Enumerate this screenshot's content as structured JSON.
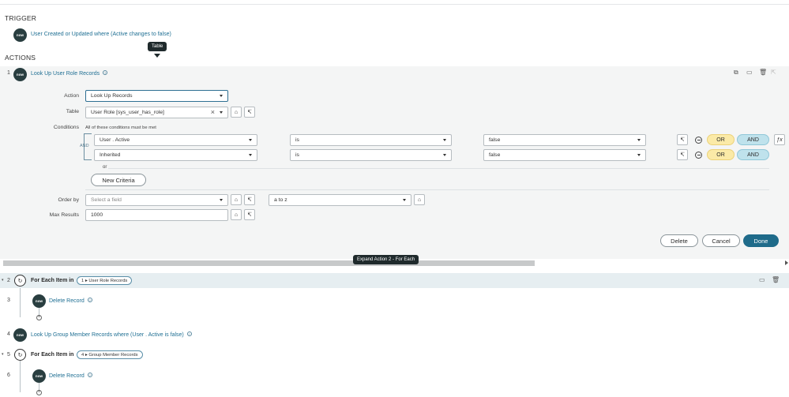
{
  "trigger": {
    "title": "TRIGGER",
    "logo": "now",
    "summary": "User Created or Updated where (Active changes to false)"
  },
  "actions_title": "ACTIONS",
  "table_tooltip": "Table",
  "step1": {
    "number": "1",
    "title": "Look Up User Role Records",
    "form": {
      "action_label": "Action",
      "action_value": "Look Up Records",
      "table_label": "Table",
      "table_value": "User Role [sys_user_has_role]",
      "conditions_label": "Conditions",
      "conditions_hint": "All of these conditions must be met",
      "and_connector": "AND",
      "or_divider": "or",
      "conditions": [
        {
          "field": "User . Active",
          "operator": "is",
          "value": "false",
          "or_label": "OR",
          "and_label": "AND"
        },
        {
          "field": "Inherited",
          "operator": "is",
          "value": "false",
          "or_label": "OR",
          "and_label": "AND"
        }
      ],
      "new_criteria": "New Criteria",
      "order_by_label": "Order by",
      "order_by_placeholder": "Select a field",
      "order_direction": "a to z",
      "max_results_label": "Max Results",
      "max_results_value": "1000"
    },
    "buttons": {
      "delete": "Delete",
      "cancel": "Cancel",
      "done": "Done"
    }
  },
  "expand_tooltip": "Expand Action 2 - For Each",
  "step2": {
    "number": "2",
    "label": "For Each Item in",
    "pill": "1 ▸ User Role Records"
  },
  "step3": {
    "number": "3",
    "title": "Delete Record"
  },
  "step4": {
    "number": "4",
    "title": "Look Up Group Member Records where (User . Active is false)"
  },
  "step5": {
    "number": "5",
    "label": "For Each Item in",
    "pill": "4 ▸ Group Member Records"
  },
  "step6": {
    "number": "6",
    "title": "Delete Record"
  },
  "colors": {
    "primary": "#1f6b8a",
    "link": "#1f6f93",
    "or_pill": "#fbeaa7",
    "and_pill": "#bfe2ec",
    "logo": "#293e40"
  }
}
